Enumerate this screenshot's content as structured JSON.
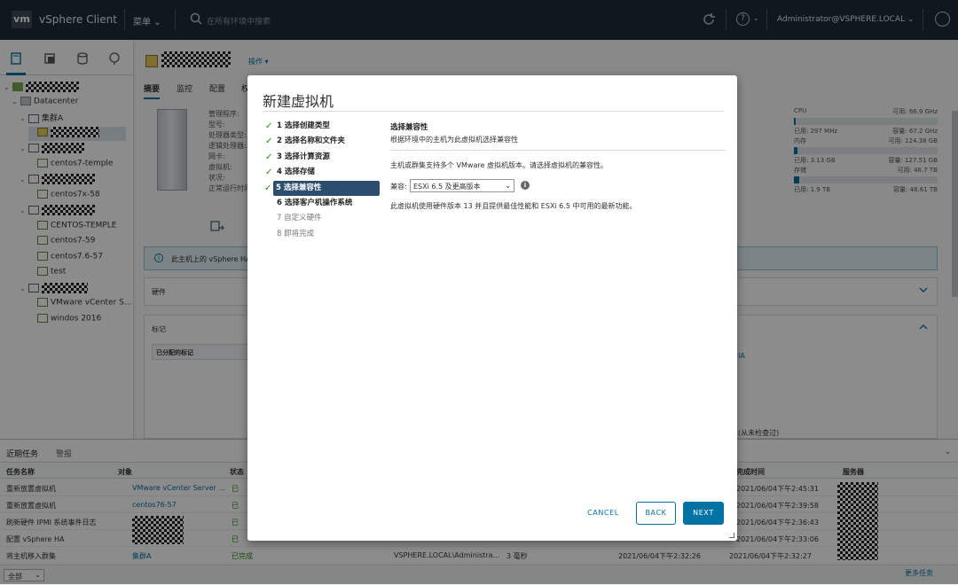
{
  "topbar": {
    "logo": "vm",
    "app_title": "vSphere Client",
    "menu_label": "菜单",
    "search_placeholder": "在所有环境中搜索",
    "user": "Administrator@VSPHERE.LOCAL"
  },
  "tree": {
    "datacenter": "Datacenter",
    "cluster": "集群A",
    "vms": [
      "centos7-temple",
      "centos7x-58",
      "CENTOS-TEMPLE",
      "centos7-59",
      "centos7.6-57",
      "test",
      "VMware vCenter S...",
      "windos 2016"
    ]
  },
  "main": {
    "actions": "操作",
    "tabs": [
      "摘要",
      "监控",
      "配置",
      "权"
    ],
    "labels": [
      "管理程序:",
      "型号:",
      "处理器类型:",
      "逻辑处理器:",
      "网卡:",
      "虚拟机:",
      "状况:",
      "正常运行时间:"
    ],
    "resources": {
      "cpu": {
        "name": "CPU",
        "free": "可用: 66.9 GHz",
        "used": "已用: 297 MHz",
        "capacity": "容量: 67.2 GHz",
        "fill": 0.005
      },
      "mem": {
        "name": "内存",
        "free": "可用: 124.38 GB",
        "used": "已用: 3.13 GB",
        "capacity": "容量: 127.51 GB",
        "fill": 0.025
      },
      "storage": {
        "name": "存储",
        "free": "可用: 46.7 TB",
        "used": "已用: 1.9 TB",
        "capacity": "容量: 48.61 TB",
        "fill": 0.04
      }
    },
    "ha_notice": "此主机上的 vSphere HA",
    "hardware_panel": "硬件",
    "tags_panel": "标记",
    "assigned_tags": "已分配的标记",
    "right_frag1": "IA",
    "right_frag2": "(从未检查过)"
  },
  "tasks": {
    "tab_recent": "近期任务",
    "tab_alarms": "警报",
    "columns": [
      "任务名称",
      "对象",
      "状态",
      "启动者",
      "排队时间",
      "开始时间",
      "完成时间",
      "服务器"
    ],
    "rows": [
      {
        "name": "重新放置虚拟机",
        "object": "VMware vCenter Server ...",
        "status": "已",
        "initiator": "",
        "queued": "",
        "start": "",
        "done": "2021/06/04下午2:45:31"
      },
      {
        "name": "重新放置虚拟机",
        "object": "centos76-57",
        "status": "已",
        "initiator": "",
        "queued": "",
        "start": "",
        "done": "2021/06/04下午2:39:58"
      },
      {
        "name": "刷新硬件 IPMI 系统事件日志",
        "object": "",
        "status": "已",
        "initiator": "",
        "queued": "",
        "start": "",
        "done": "2021/06/04下午2:36:43"
      },
      {
        "name": "配置 vSphere HA",
        "object": "",
        "status": "已",
        "initiator": "",
        "queued": "",
        "start": "",
        "done": "2021/06/04下午2:33:06"
      },
      {
        "name": "将主机移入群集",
        "object": "集群A",
        "status": "已完成",
        "initiator": "VSPHERE.LOCAL\\Administra...",
        "queued": "3 毫秒",
        "start": "2021/06/04下午2:32:26",
        "done": "2021/06/04下午2:32:27"
      }
    ],
    "filter": "全部",
    "more": "更多任务"
  },
  "modal": {
    "title": "新建虚拟机",
    "steps": [
      {
        "label": "1 选择创建类型",
        "state": "done"
      },
      {
        "label": "2 选择名称和文件夹",
        "state": "done"
      },
      {
        "label": "3 选择计算资源",
        "state": "done"
      },
      {
        "label": "4 选择存储",
        "state": "done"
      },
      {
        "label": "5 选择兼容性",
        "state": "current"
      },
      {
        "label": "6 选择客户机操作系统",
        "state": "todo"
      },
      {
        "label": "7 自定义硬件",
        "state": "dim"
      },
      {
        "label": "8 即将完成",
        "state": "dim"
      }
    ],
    "content_title": "选择兼容性",
    "content_subtitle": "根据环境中的主机为此虚拟机选择兼容性",
    "description": "主机或群集支持多个 VMware 虚拟机版本。请选择虚拟机的兼容性。",
    "compat_label": "兼容:",
    "compat_value": "ESXi 6.5 及更高版本",
    "note": "此虚拟机使用硬件版本 13 并且提供最佳性能和 ESXi 6.5 中可用的最新功能。",
    "buttons": {
      "cancel": "CANCEL",
      "back": "BACK",
      "next": "NEXT"
    }
  }
}
